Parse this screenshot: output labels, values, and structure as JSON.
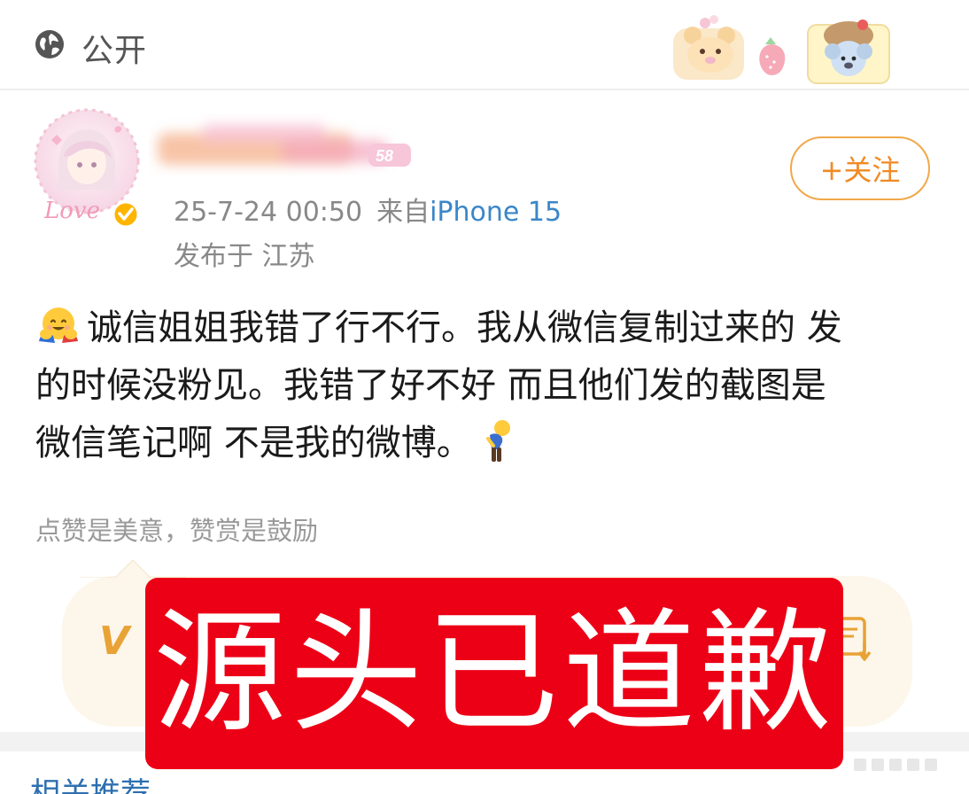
{
  "topbar": {
    "visibility_icon": "globe-icon",
    "visibility_label": "公开",
    "decoration": "cute-stickers"
  },
  "author": {
    "avatar": "anime-avatar",
    "avatar_caption": "Love",
    "verified_icon": "verified-badge-icon",
    "username_badge": "58",
    "timestamp": "25-7-24 00:50",
    "from_label": "来自",
    "device": "iPhone 15",
    "location": "发布于 江苏",
    "follow_label": "+关注"
  },
  "post": {
    "emoji_start": "hugging-face-icon",
    "lines": [
      "诚信姐姐我错了行不行。我从微信复制过来的 发",
      "的时候没粉见。我错了好不好 而且他们发的截图是",
      "微信笔记啊 不是我的微博。"
    ],
    "emoji_end": "bowing-person-icon"
  },
  "reward": {
    "hint": "点赞是美意，赞赏是鼓励",
    "left_glyph": "V",
    "right_icon": "reward-download-icon"
  },
  "overlay": {
    "text": "源头已道歉"
  },
  "related": {
    "label": "相关推荐"
  },
  "colors": {
    "accent_orange": "#f08a24",
    "link_blue": "#3a86c8",
    "banner_red": "#ec0016"
  }
}
